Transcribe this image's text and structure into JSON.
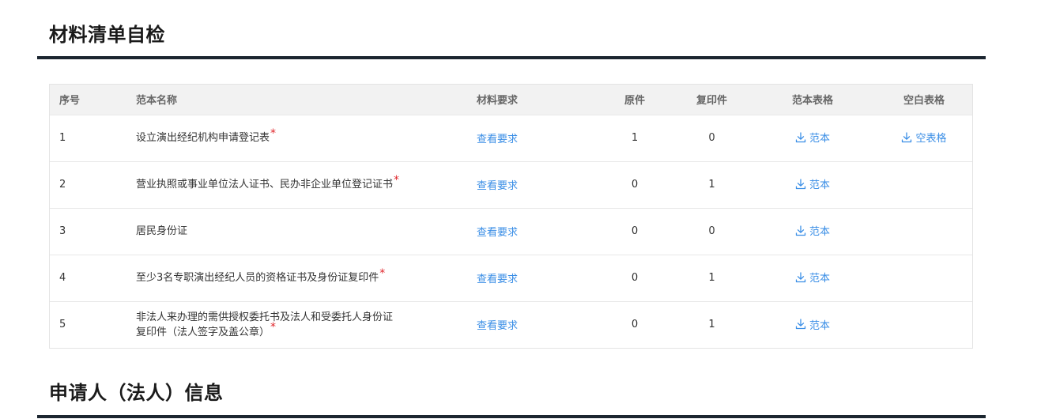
{
  "sections": {
    "materials_title": "材料清单自检",
    "applicant_title": "申请人（法人）信息"
  },
  "table": {
    "headers": [
      "序号",
      "范本名称",
      "材料要求",
      "原件",
      "复印件",
      "范本表格",
      "空白表格"
    ],
    "rows": [
      {
        "index": "1",
        "name": "设立演出经纪机构申请登记表",
        "name_line2": "",
        "required": "*",
        "req_link": "查看要求",
        "original": "1",
        "copy": "0",
        "template": "范本",
        "blank": "空表格"
      },
      {
        "index": "2",
        "name": "营业执照或事业单位法人证书、民办非企业单位登记证书",
        "name_line2": "",
        "required": "*",
        "req_link": "查看要求",
        "original": "0",
        "copy": "1",
        "template": "范本",
        "blank": ""
      },
      {
        "index": "3",
        "name": "居民身份证",
        "name_line2": "",
        "required": "",
        "req_link": "查看要求",
        "original": "0",
        "copy": "0",
        "template": "范本",
        "blank": ""
      },
      {
        "index": "4",
        "name": "至少3名专职演出经纪人员的资格证书及身份证复印件",
        "name_line2": "",
        "required": "*",
        "req_link": "查看要求",
        "original": "0",
        "copy": "1",
        "template": "范本",
        "blank": ""
      },
      {
        "index": "5",
        "name": "非法人来办理的需供授权委托书及法人和受委托人身份证",
        "name_line2": "复印件（法人签字及盖公章）",
        "required": "*",
        "req_link": "查看要求",
        "original": "0",
        "copy": "1",
        "template": "范本",
        "blank": ""
      }
    ]
  },
  "icons": {
    "download": "download-icon"
  },
  "colors": {
    "link": "#3a8ee6",
    "required": "#e0262b",
    "rule": "#1c2630",
    "header_bg": "#f2f2f2"
  }
}
